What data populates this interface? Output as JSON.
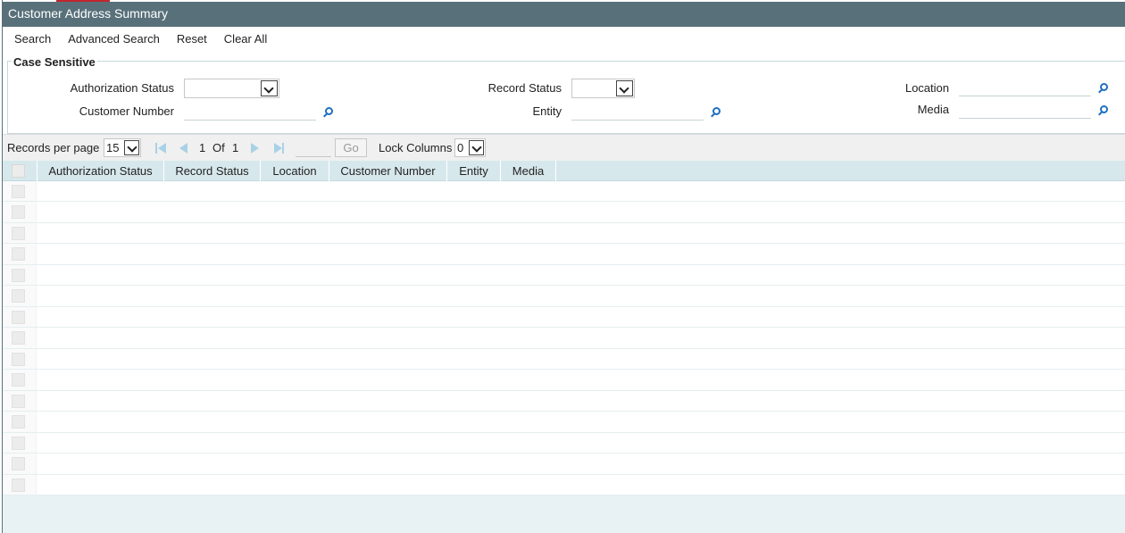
{
  "window": {
    "title": "Customer Address Summary"
  },
  "toolbar": {
    "search": "Search",
    "advanced_search": "Advanced Search",
    "reset": "Reset",
    "clear_all": "Clear All"
  },
  "criteria": {
    "legend": "Case Sensitive",
    "authorization_status": {
      "label": "Authorization Status",
      "value": ""
    },
    "record_status": {
      "label": "Record Status",
      "value": ""
    },
    "location": {
      "label": "Location",
      "value": ""
    },
    "customer_number": {
      "label": "Customer Number",
      "value": ""
    },
    "entity": {
      "label": "Entity",
      "value": ""
    },
    "media": {
      "label": "Media",
      "value": ""
    }
  },
  "pager": {
    "records_per_page_label": "Records per page",
    "records_per_page_value": "15",
    "current_page": "1",
    "of_label": "Of",
    "total_pages": "1",
    "go_label": "Go",
    "lock_columns_label": "Lock Columns",
    "lock_columns_value": "0"
  },
  "grid": {
    "columns": [
      "Authorization Status",
      "Record Status",
      "Location",
      "Customer Number",
      "Entity",
      "Media"
    ],
    "row_count": 15
  },
  "colors": {
    "titlebar": "#58707a",
    "header": "#d7e8ec",
    "footer": "#e8f1f3",
    "accent": "#c0262c",
    "lookup_icon": "#1f6fbf"
  }
}
